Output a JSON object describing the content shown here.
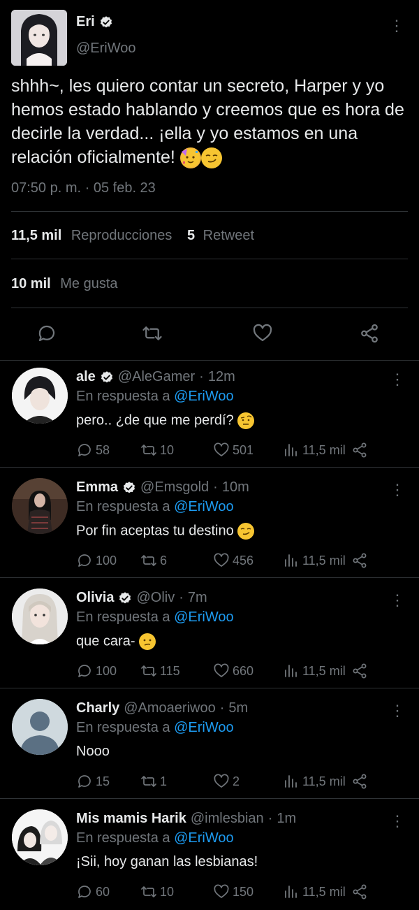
{
  "tweet": {
    "author_name": "Eri",
    "author_handle": "@EriWoo",
    "text": "shhh~, les quiero contar un secreto, Harper y yo hemos estado hablando y creemos que es hora de decirle la verdad... ¡ella y yo estamos en una relación oficialmente! ",
    "emojis": [
      "partying-face-emoji",
      "smirk-emoji"
    ],
    "timestamp": "07:50 p. m. · 05 feb. 23",
    "views_count": "11,5 mil",
    "views_label": "Reproducciones",
    "retweets_count": "5",
    "retweets_label": "Retweet",
    "likes_count": "10 mil",
    "likes_label": "Me gusta",
    "actions": [
      "reply-icon",
      "retweet-icon",
      "like-icon",
      "share-icon"
    ]
  },
  "replies": [
    {
      "name": "ale",
      "verified": true,
      "handle": "@AleGamer",
      "time": "12m",
      "replying_label": "En respuesta a",
      "replying_to": "@EriWoo",
      "text": "pero.. ¿de que me perdí?",
      "emoji": "raised-eyebrow-emoji",
      "replies": "58",
      "retweets": "10",
      "likes": "501",
      "views": "11,5 mil"
    },
    {
      "name": "Emma",
      "verified": true,
      "handle": "@Emsgold",
      "time": "10m",
      "replying_label": "En respuesta a",
      "replying_to": "@EriWoo",
      "text": "Por fin aceptas tu destino",
      "emoji": "smirk-emoji",
      "replies": "100",
      "retweets": "6",
      "likes": "456",
      "views": "11,5 mil"
    },
    {
      "name": "Olivia",
      "verified": true,
      "handle": "@Oliv",
      "time": "7m",
      "replying_label": "En respuesta a",
      "replying_to": "@EriWoo",
      "text": "que cara-",
      "emoji": "confused-emoji",
      "replies": "100",
      "retweets": "115",
      "likes": "660",
      "views": "11,5 mil"
    },
    {
      "name": "Charly",
      "verified": false,
      "handle": "@Amoaeriwoo",
      "time": "5m",
      "replying_label": "En respuesta a",
      "replying_to": "@EriWoo",
      "text": "Nooo",
      "emoji": "",
      "replies": "15",
      "retweets": "1",
      "likes": "2",
      "views": "11,5 mil"
    },
    {
      "name": "Mis mamis Harik",
      "verified": false,
      "handle": "@imlesbian",
      "time": "1m",
      "replying_label": "En respuesta a",
      "replying_to": "@EriWoo",
      "text": "¡Sii, hoy ganan las lesbianas!",
      "emoji": "",
      "replies": "60",
      "retweets": "10",
      "likes": "150",
      "views": "11,5 mil"
    }
  ],
  "meta_separator": "·",
  "colors": {
    "background": "#000000",
    "text": "#e7e9ea",
    "muted": "#71767b",
    "accent": "#1d9bf0",
    "divider": "#2f3336"
  }
}
